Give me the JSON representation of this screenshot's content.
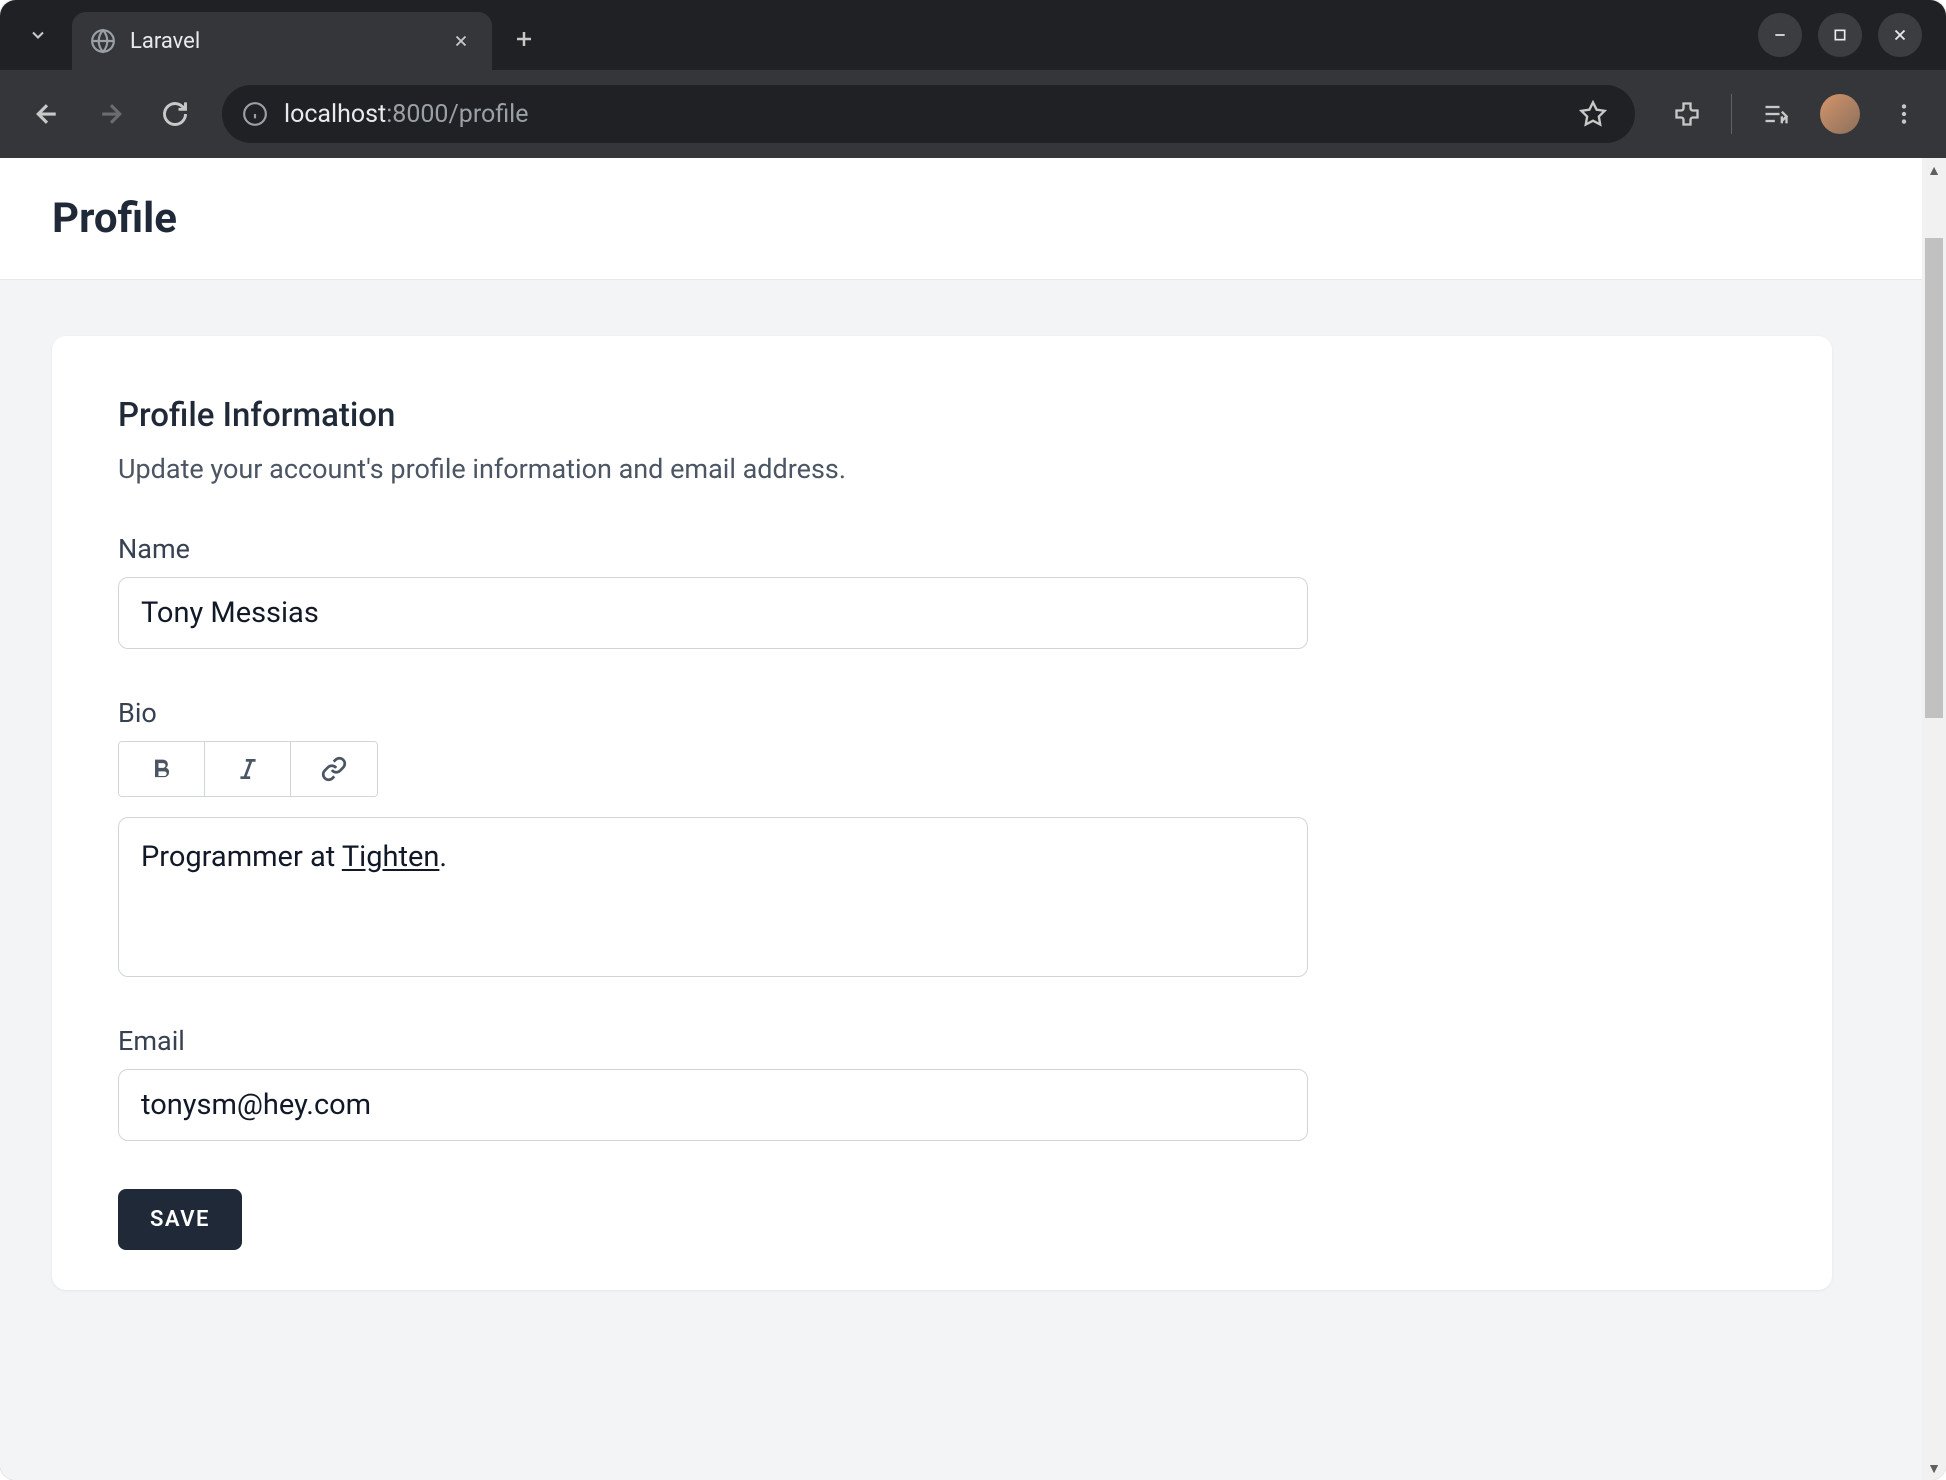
{
  "browser": {
    "tab_title": "Laravel",
    "url_host": "localhost",
    "url_port_path": ":8000/profile"
  },
  "page": {
    "title": "Profile",
    "section": {
      "heading": "Profile Information",
      "description": "Update your account's profile information and email address."
    },
    "fields": {
      "name": {
        "label": "Name",
        "value": "Tony Messias"
      },
      "bio": {
        "label": "Bio",
        "text_prefix": "Programmer at ",
        "link_text": "Tighten",
        "text_suffix": "."
      },
      "email": {
        "label": "Email",
        "value": "tonysm@hey.com"
      }
    },
    "actions": {
      "save_label": "SAVE"
    }
  }
}
